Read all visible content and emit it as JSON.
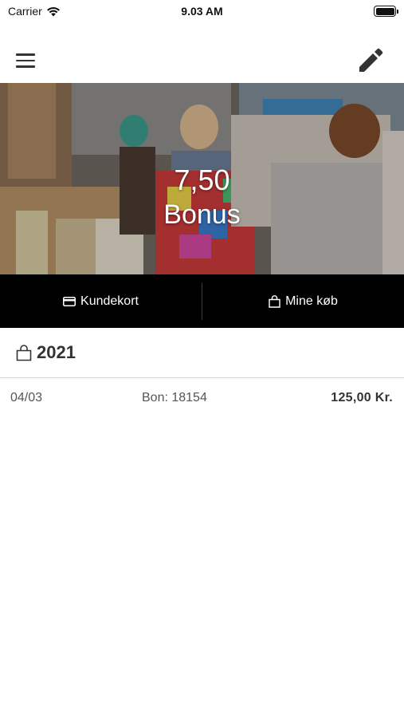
{
  "status_bar": {
    "carrier": "Carrier",
    "time": "9.03 AM"
  },
  "hero": {
    "bonus_value": "7,50",
    "bonus_label": "Bonus"
  },
  "actions": {
    "customer_card": "Kundekort",
    "my_purchases": "Mine køb"
  },
  "purchases": {
    "year": "2021",
    "rows": [
      {
        "date": "04/03",
        "receipt": "Bon: 18154",
        "amount": "125,00 Kr."
      }
    ]
  },
  "icons": {
    "menu": "hamburger-icon",
    "edit": "pencil-icon",
    "card": "credit-card-icon",
    "bag": "shopping-bag-icon",
    "wifi": "wifi-icon",
    "battery": "battery-icon"
  },
  "colors": {
    "action_bar_bg": "#000000",
    "text_dark": "#333333"
  }
}
